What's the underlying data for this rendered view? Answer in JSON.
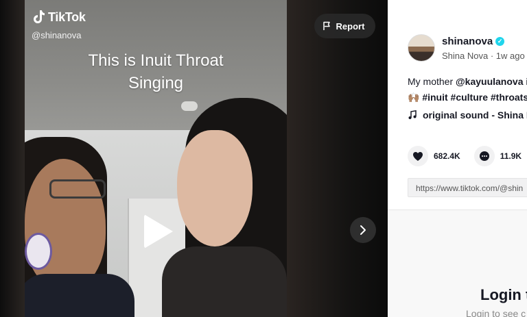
{
  "video": {
    "brand": "TikTok",
    "handle": "@shinanova",
    "caption_line1": "This is Inuit Throat",
    "caption_line2": "Singing",
    "report_label": "Report"
  },
  "author": {
    "username": "shinanova",
    "display_name": "Shina Nova",
    "time_ago": "1w ago",
    "verified": true
  },
  "description": {
    "prefix": "My mother ",
    "mention": "@kayuulanova",
    "rest": " i",
    "hashtags_line": "🙌🏽 #inuit #culture #throats"
  },
  "music": {
    "label": "original sound - Shina N"
  },
  "stats": {
    "likes": "682.4K",
    "comments": "11.9K"
  },
  "share": {
    "url": "https://www.tiktok.com/@shin"
  },
  "login": {
    "title": "Login t",
    "subtitle": "Login to see c"
  },
  "colors": {
    "verified_badge": "#20d5ec",
    "panel_bg": "#ffffff",
    "text_primary": "#161823"
  }
}
